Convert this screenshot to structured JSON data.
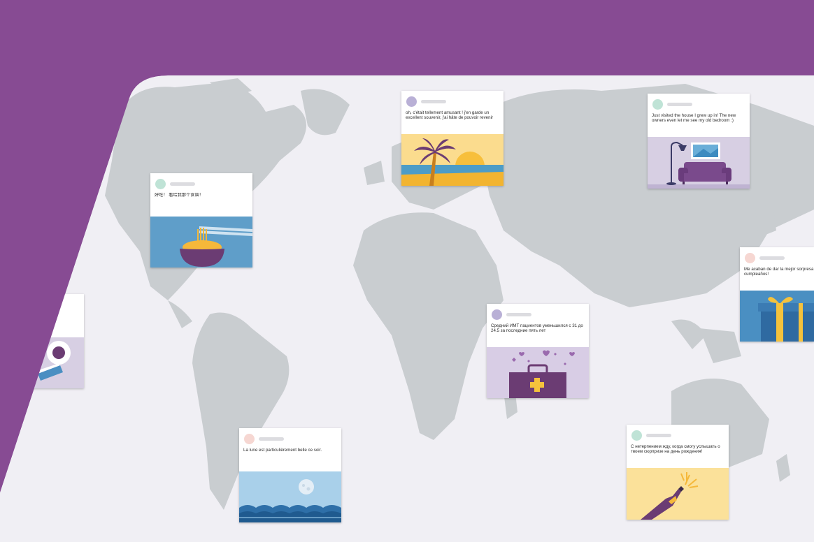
{
  "colors": {
    "purple": "#874b93",
    "map_bg": "#f0eff4",
    "land": "#c9cdd0",
    "avatar_purple": "#b9b0d6",
    "avatar_green": "#bfe3d6",
    "avatar_pink": "#f6d7d2"
  },
  "posts": [
    {
      "id": "fr",
      "message": "oh, c'était tellement amusant ! j'en garde un excellent souvenir, j'ai hâte de pouvoir revenir",
      "illustration": "palm-beach-sunset-icon",
      "avatar_color": "#b9b0d6"
    },
    {
      "id": "en",
      "message": "Just visited the house I grew up in! The new owners even let me see my old bedroom :)",
      "illustration": "sofa-lamp-living-room-icon",
      "avatar_color": "#bfe3d6"
    },
    {
      "id": "zh",
      "message": "好吃！ 看给我那个食谱！",
      "illustration": "noodle-bowl-icon",
      "avatar_color": "#bfe3d6"
    },
    {
      "id": "es",
      "message": "Me acaban de dar la mejor sorpresa de cumpleaños!",
      "illustration": "gift-box-icon",
      "avatar_color": "#f6d7d2"
    },
    {
      "id": "ru1",
      "message": "Средний ИМТ пациентов уменьшился с 31 до 24.5 за последние пять лет",
      "illustration": "medical-case-icon",
      "avatar_color": "#b9b0d6"
    },
    {
      "id": "ru2",
      "message": "С нетерпением жду, когда смогу услышать о твоем сюрпризе на день рождения!",
      "illustration": "champagne-bottle-icon",
      "avatar_color": "#bfe3d6"
    },
    {
      "id": "fr2",
      "message": "La lune est particulièrement belle ce soir.",
      "illustration": "moon-sea-icon",
      "avatar_color": "#f6d7d2"
    },
    {
      "id": "partial",
      "message": "",
      "illustration": "coffee-cup-icon",
      "avatar_color": "#bfe3d6"
    }
  ]
}
